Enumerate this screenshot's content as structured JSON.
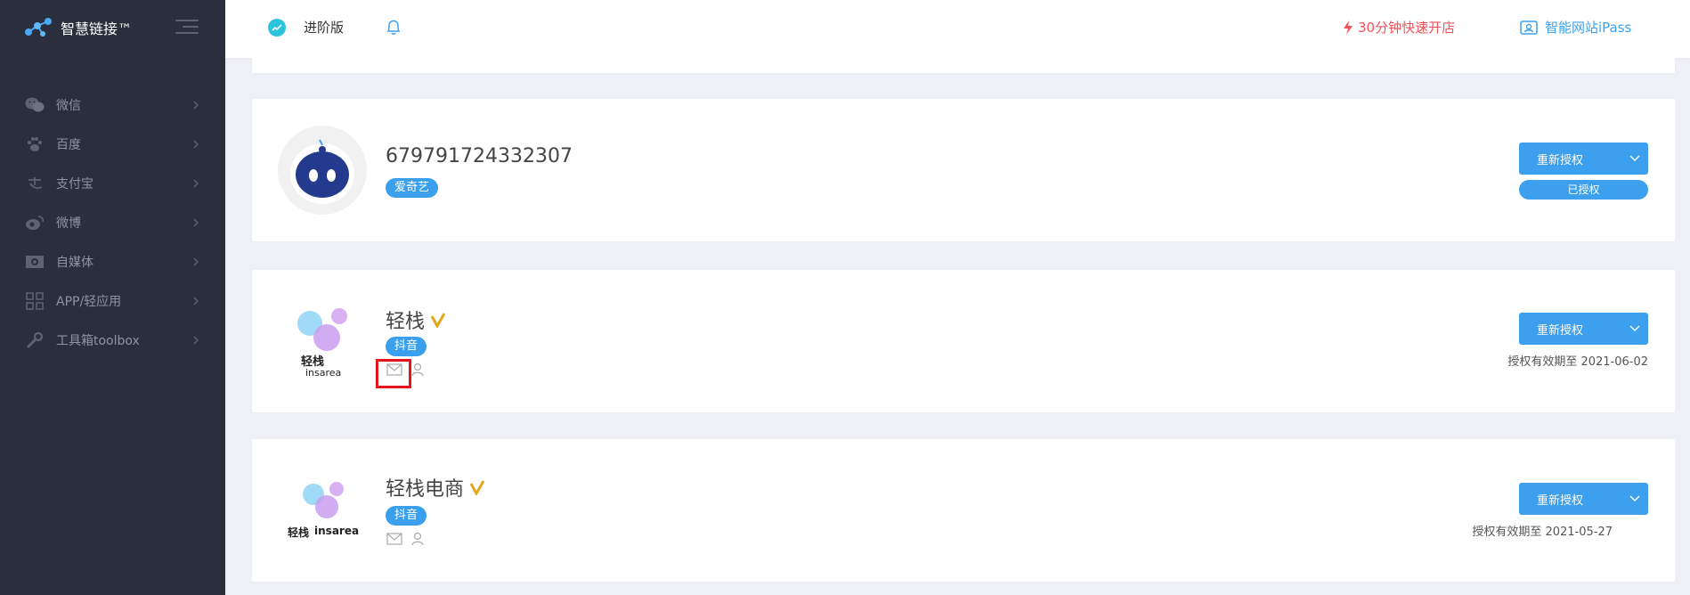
{
  "app": {
    "brand": "智慧链接™"
  },
  "sidebar": {
    "items": [
      {
        "label": "微信",
        "icon": "wechat-icon"
      },
      {
        "label": "百度",
        "icon": "baidu-paw-icon"
      },
      {
        "label": "支付宝",
        "icon": "alipay-icon"
      },
      {
        "label": "微博",
        "icon": "weibo-icon"
      },
      {
        "label": "自媒体",
        "icon": "media-icon"
      },
      {
        "label": "APP/轻应用",
        "icon": "app-grid-icon"
      },
      {
        "label": "工具箱toolbox",
        "icon": "wrench-icon"
      }
    ]
  },
  "header": {
    "edition": "进阶版",
    "quick_open": "30分钟快速开店",
    "ipass": "智能网站iPass"
  },
  "accounts": [
    {
      "name": "679791724332307",
      "platform": "爱奇艺",
      "action": "重新授权",
      "status": "已授权"
    },
    {
      "name": "轻栈",
      "platform": "抖音",
      "action": "重新授权",
      "expire": "授权有效期至 2021-06-02",
      "logo_text": "轻栈",
      "logo_sub": "insarea"
    },
    {
      "name": "轻栈电商",
      "platform": "抖音",
      "action": "重新授权",
      "expire": "授权有效期至 2021-05-27",
      "logo_text": "轻栈",
      "logo_sub": "insarea"
    }
  ],
  "colors": {
    "sidebar_bg": "#2b2e3d",
    "accent_blue": "#3ca0ee",
    "accent_red": "#f0545b",
    "highlight": "#e8141b"
  }
}
